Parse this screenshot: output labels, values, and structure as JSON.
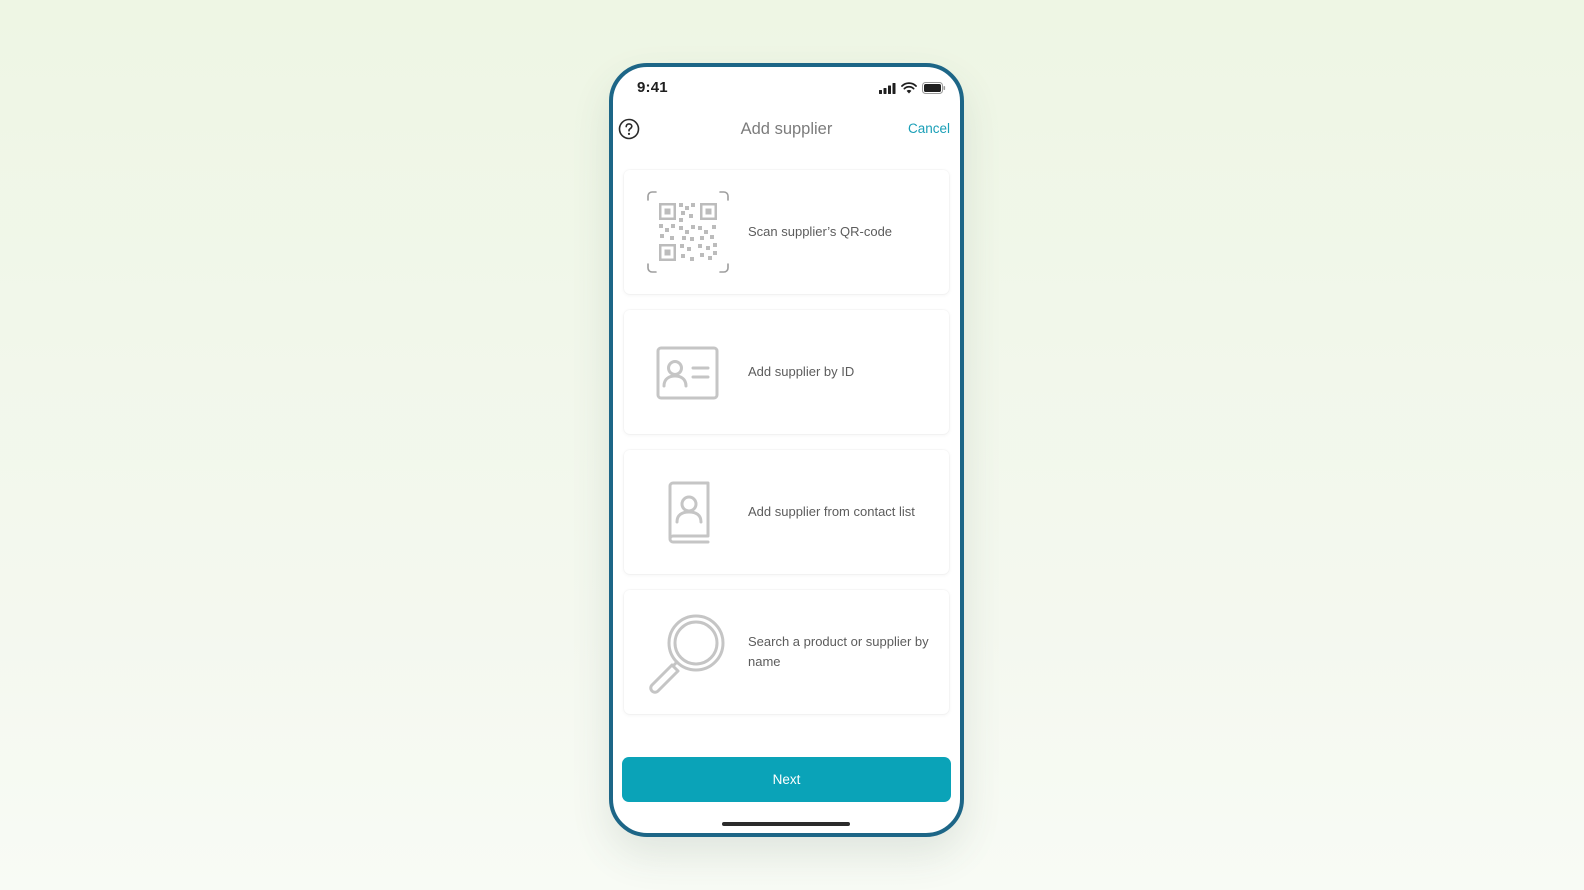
{
  "status_bar": {
    "time": "9:41",
    "icons": [
      "cellular-signal-icon",
      "wifi-icon",
      "battery-icon"
    ]
  },
  "nav": {
    "help_icon": "question-circle-icon",
    "title": "Add supplier",
    "cancel_label": "Cancel"
  },
  "options": [
    {
      "icon": "qr-code-icon",
      "label": "Scan supplier’s QR-code"
    },
    {
      "icon": "id-card-icon",
      "label": "Add supplier by ID"
    },
    {
      "icon": "contact-book-icon",
      "label": "Add supplier from contact list"
    },
    {
      "icon": "magnifier-icon",
      "label": "Search a product or supplier by name"
    }
  ],
  "footer": {
    "next_label": "Next"
  },
  "colors": {
    "accent": "#0aa3b8",
    "link": "#1a9fb7",
    "phone_frame": "#1d6687",
    "icon_gray": "#c9c9c9"
  }
}
